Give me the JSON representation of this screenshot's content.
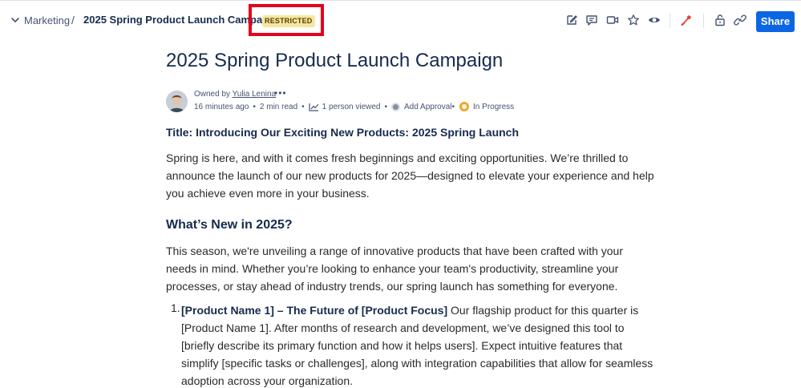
{
  "header": {
    "space": "Marketing",
    "separator": "/",
    "page_title": "2025 Spring Product Launch Campaign",
    "restriction_badge": "RESTRICTED",
    "share_label": "Share",
    "icons": [
      "edit-icon",
      "comment-icon",
      "video-icon",
      "star-icon",
      "watch-icon",
      "brush-icon",
      "lock-icon",
      "link-icon"
    ]
  },
  "page": {
    "title": "2025 Spring Product Launch Campaign",
    "owner_prefix": "Owned by",
    "owner_name": "Yulia Lenina",
    "more": "•••",
    "updated": "16 minutes ago",
    "read_time": "2 min read",
    "viewed": "1 person viewed",
    "approval": "Add Approval",
    "status": "In Progress",
    "status_color": "#f5a623"
  },
  "body": {
    "heading": "Title: Introducing Our Exciting New Products: 2025 Spring Launch",
    "intro": "Spring is here, and with it comes fresh beginnings and exciting opportunities. We’re thrilled to announce the launch of our new products for 2025—designed to elevate your experience and help you achieve even more in your business.",
    "section_title": "What’s New in 2025?",
    "section_text": "This season, we're unveiling a range of innovative products that have been crafted with your needs in mind. Whether you’re looking to enhance your team's productivity, streamline your processes, or stay ahead of industry trends, our spring launch has something for everyone.",
    "list": [
      {
        "number": "1.",
        "bold": "[Product Name 1] – The Future of [Product Focus]",
        "text": " Our flagship product for this quarter is [Product Name 1]. After months of research and development, we’ve designed this tool to [briefly describe its primary function and how it helps users]. Expect intuitive features that simplify [specific tasks or challenges], along with integration capabilities that allow for seamless adoption across your organization."
      }
    ]
  },
  "colors": {
    "accent": "#0c66e4",
    "restricted_highlight": "#e5001c",
    "badge_bg": "#f8e6a0"
  }
}
